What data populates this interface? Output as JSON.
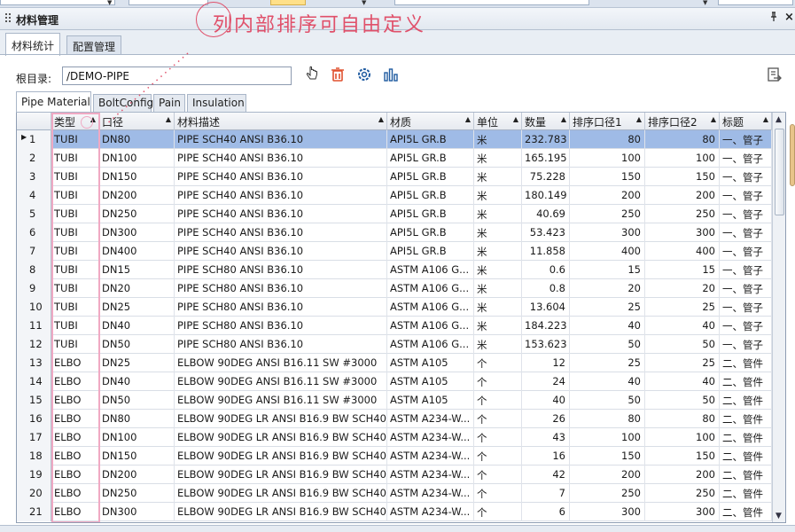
{
  "panel": {
    "title": "材料管理",
    "pin_glyph": "ᵖ",
    "close_glyph": "×"
  },
  "annotation": {
    "text": "列内部排序可自由定义",
    "color": "#e0506a"
  },
  "outer_tabs": [
    {
      "label": "材料统计",
      "active": true
    },
    {
      "label": "配置管理",
      "active": false
    }
  ],
  "root": {
    "label": "根目录:",
    "value": "/DEMO-PIPE"
  },
  "toolbar_icons": [
    "hand-pointer-icon",
    "trash-icon",
    "settings-gear-icon",
    "bar-chart-icon",
    "export-icon"
  ],
  "inner_tabs": [
    {
      "label": "Pipe Material",
      "active": true
    },
    {
      "label": "BoltConfig",
      "active": false
    },
    {
      "label": "Pain",
      "active": false
    },
    {
      "label": "Insulation",
      "active": false
    }
  ],
  "columns": [
    "类型",
    "口径",
    "材料描述",
    "材质",
    "单位",
    "数量",
    "排序口径1",
    "排序口径2",
    "标题"
  ],
  "rows": [
    [
      "1",
      "TUBI",
      "DN80",
      "PIPE SCH40 ANSI B36.10",
      "API5L GR.B",
      "米",
      "232.783",
      "80",
      "80",
      "一、管子"
    ],
    [
      "2",
      "TUBI",
      "DN100",
      "PIPE SCH40 ANSI B36.10",
      "API5L GR.B",
      "米",
      "165.195",
      "100",
      "100",
      "一、管子"
    ],
    [
      "3",
      "TUBI",
      "DN150",
      "PIPE SCH40 ANSI B36.10",
      "API5L GR.B",
      "米",
      "75.228",
      "150",
      "150",
      "一、管子"
    ],
    [
      "4",
      "TUBI",
      "DN200",
      "PIPE SCH40 ANSI B36.10",
      "API5L GR.B",
      "米",
      "180.149",
      "200",
      "200",
      "一、管子"
    ],
    [
      "5",
      "TUBI",
      "DN250",
      "PIPE SCH40 ANSI B36.10",
      "API5L GR.B",
      "米",
      "40.69",
      "250",
      "250",
      "一、管子"
    ],
    [
      "6",
      "TUBI",
      "DN300",
      "PIPE SCH40 ANSI B36.10",
      "API5L GR.B",
      "米",
      "53.423",
      "300",
      "300",
      "一、管子"
    ],
    [
      "7",
      "TUBI",
      "DN400",
      "PIPE SCH40 ANSI B36.10",
      "API5L GR.B",
      "米",
      "11.858",
      "400",
      "400",
      "一、管子"
    ],
    [
      "8",
      "TUBI",
      "DN15",
      "PIPE SCH80 ANSI B36.10",
      "ASTM A106 G...",
      "米",
      "0.6",
      "15",
      "15",
      "一、管子"
    ],
    [
      "9",
      "TUBI",
      "DN20",
      "PIPE SCH80 ANSI B36.10",
      "ASTM A106 G...",
      "米",
      "0.8",
      "20",
      "20",
      "一、管子"
    ],
    [
      "10",
      "TUBI",
      "DN25",
      "PIPE SCH80 ANSI B36.10",
      "ASTM A106 G...",
      "米",
      "13.604",
      "25",
      "25",
      "一、管子"
    ],
    [
      "11",
      "TUBI",
      "DN40",
      "PIPE SCH80 ANSI B36.10",
      "ASTM A106 G...",
      "米",
      "184.223",
      "40",
      "40",
      "一、管子"
    ],
    [
      "12",
      "TUBI",
      "DN50",
      "PIPE SCH80 ANSI B36.10",
      "ASTM A106 G...",
      "米",
      "153.623",
      "50",
      "50",
      "一、管子"
    ],
    [
      "13",
      "ELBO",
      "DN25",
      "ELBOW 90DEG ANSI B16.11 SW #3000",
      "ASTM A105",
      "个",
      "12",
      "25",
      "25",
      "二、管件"
    ],
    [
      "14",
      "ELBO",
      "DN40",
      "ELBOW 90DEG ANSI B16.11 SW #3000",
      "ASTM A105",
      "个",
      "24",
      "40",
      "40",
      "二、管件"
    ],
    [
      "15",
      "ELBO",
      "DN50",
      "ELBOW 90DEG ANSI B16.11 SW #3000",
      "ASTM A105",
      "个",
      "40",
      "50",
      "50",
      "二、管件"
    ],
    [
      "16",
      "ELBO",
      "DN80",
      "ELBOW 90DEG LR ANSI B16.9 BW SCH40",
      "ASTM A234-W...",
      "个",
      "26",
      "80",
      "80",
      "二、管件"
    ],
    [
      "17",
      "ELBO",
      "DN100",
      "ELBOW 90DEG LR ANSI B16.9 BW SCH40",
      "ASTM A234-W...",
      "个",
      "43",
      "100",
      "100",
      "二、管件"
    ],
    [
      "18",
      "ELBO",
      "DN150",
      "ELBOW 90DEG LR ANSI B16.9 BW SCH40",
      "ASTM A234-W...",
      "个",
      "16",
      "150",
      "150",
      "二、管件"
    ],
    [
      "19",
      "ELBO",
      "DN200",
      "ELBOW 90DEG LR ANSI B16.9 BW SCH40",
      "ASTM A234-W...",
      "个",
      "42",
      "200",
      "200",
      "二、管件"
    ],
    [
      "20",
      "ELBO",
      "DN250",
      "ELBOW 90DEG LR ANSI B16.9 BW SCH40",
      "ASTM A234-W...",
      "个",
      "7",
      "250",
      "250",
      "二、管件"
    ],
    [
      "21",
      "ELBO",
      "DN300",
      "ELBOW 90DEG LR ANSI B16.9 BW SCH40",
      "ASTM A234-W...",
      "个",
      "6",
      "300",
      "300",
      "二、管件"
    ]
  ],
  "selected_row": 0,
  "colors": {
    "selection": "#9fbbe6",
    "highlight_column": "#f0a9c3",
    "annotation": "#e0506a"
  }
}
